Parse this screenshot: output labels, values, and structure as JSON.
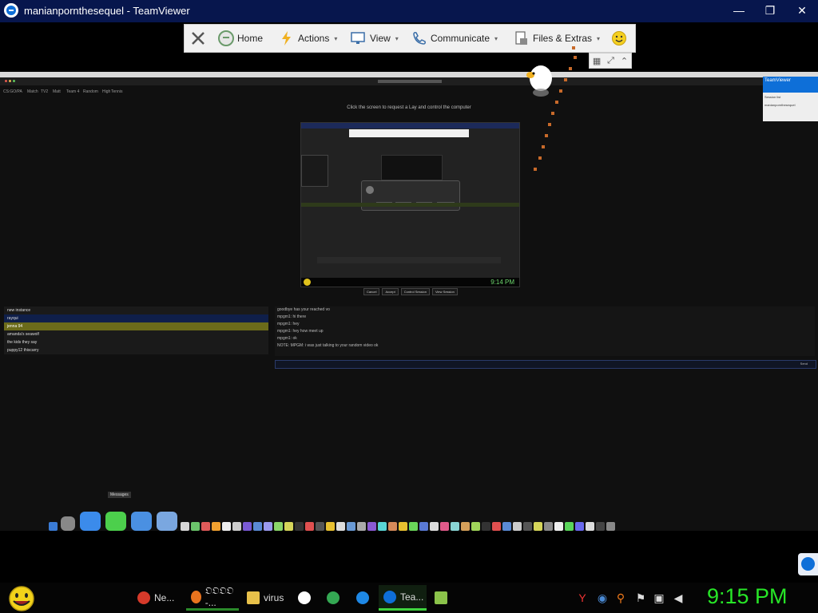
{
  "window": {
    "title": "manianpornthesequel - TeamViewer",
    "minimize": "—",
    "restore": "❐",
    "close": "✕"
  },
  "toolbar": {
    "close_icon": "close-icon",
    "home": "Home",
    "actions": "Actions",
    "view": "View",
    "communicate": "Communicate",
    "files_extras": "Files & Extras",
    "caret": "▾"
  },
  "mini_controls": {
    "grid": "▦",
    "expand": "⤢",
    "collapse": "⌃"
  },
  "remote": {
    "hint": "Click the screen to request a Lay and control the computer",
    "tabs": [
      "CS:GO/PA",
      "Match",
      "TV2",
      "Matt",
      "Team 4",
      "Random",
      "High",
      "Tennis"
    ],
    "nested_clock": "9:14 PM",
    "nested_buttons": [
      "Cancel",
      "Accept",
      "Control Session",
      "View Session"
    ],
    "list_items": [
      "new instance",
      "rayqui",
      "jenna 94",
      "amanda's seawolf",
      "the kids they say",
      "puppy12 thiscarry"
    ],
    "chat_lines": [
      "goodbye has your reached vo",
      "mpgm1: hi there",
      "mpgm1: hey",
      "mpgm1: hey how meet up",
      "mpgm1: ok",
      "NOTE: MPGM: i was just talking to your random video ok"
    ],
    "chat_send": "Send",
    "dock_tooltip": "Messages",
    "tv_panel_title": "TeamViewer",
    "tv_panel_line1": "Session list",
    "tv_panel_line2": "manianpornthesequel"
  },
  "taskbar": {
    "tasks": [
      {
        "label": "Ne...",
        "icon": "chrome-icon",
        "color": "#d63a2a"
      },
      {
        "label": "𝔒𝔒𝔒𝔒 -...",
        "icon": "firefox-icon",
        "color": "#e8731e"
      },
      {
        "label": "virus",
        "icon": "folder-icon",
        "color": "#e8c14a"
      },
      {
        "label": "",
        "icon": "yandex-icon",
        "color": "#ffffff"
      },
      {
        "label": "",
        "icon": "chrome-color-icon",
        "color": "#34a853"
      },
      {
        "label": "",
        "icon": "app-q-icon",
        "color": "#1e88e5"
      },
      {
        "label": "Tea...",
        "icon": "teamviewer-icon",
        "color": "#0e6fd8"
      },
      {
        "label": "",
        "icon": "green-app-icon",
        "color": "#8bc34a"
      }
    ],
    "clock": "9:15 PM"
  },
  "colors": {
    "titlebar": "#07164d",
    "clock": "#27e627",
    "accent": "#0e6fd8"
  }
}
